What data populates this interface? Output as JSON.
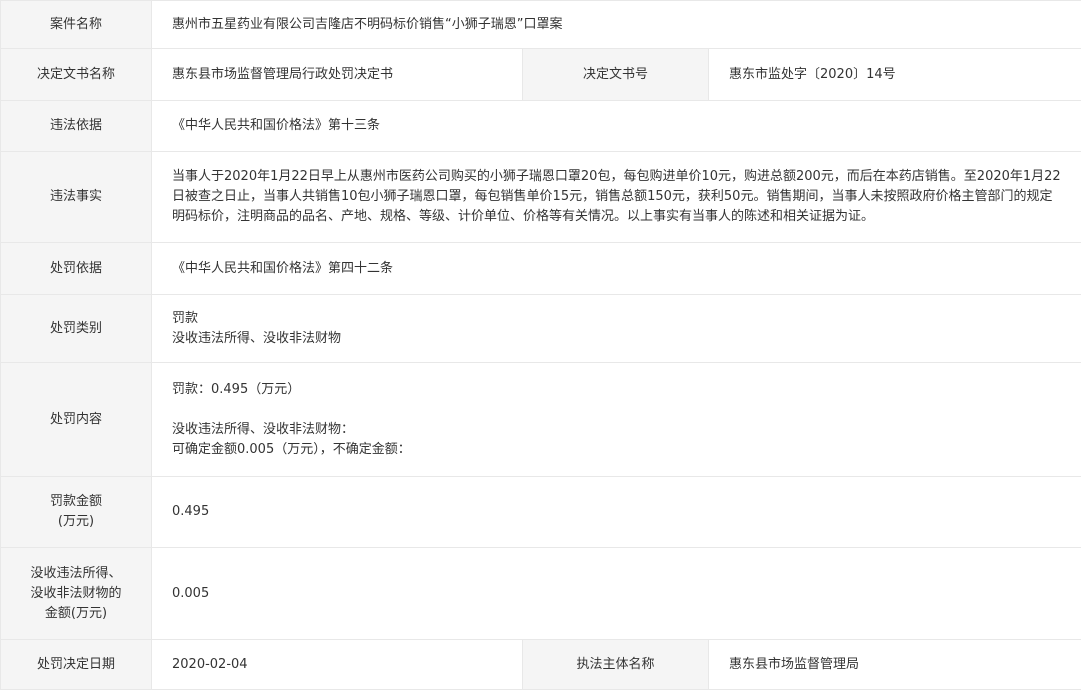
{
  "rows": {
    "case_name": {
      "label": "案件名称",
      "value": "惠州市五星药业有限公司吉隆店不明码标价销售“小狮子瑞恩”口罩案"
    },
    "decision_doc_name": {
      "label": "决定文书名称",
      "value": "惠东县市场监督管理局行政处罚决定书"
    },
    "decision_doc_no": {
      "label": "决定文书号",
      "value": "惠东市监处字〔2020〕14号"
    },
    "violation_basis": {
      "label": "违法依据",
      "value": "《中华人民共和国价格法》第十三条"
    },
    "violation_facts": {
      "label": "违法事实",
      "value": "当事人于2020年1月22日早上从惠州市医药公司购买的小狮子瑞恩口罩20包，每包购进单价10元，购进总额200元，而后在本药店销售。至2020年1月22日被查之日止，当事人共销售10包小狮子瑞恩口罩，每包销售单价15元，销售总额150元，获利50元。销售期间，当事人未按照政府价格主管部门的规定明码标价，注明商品的品名、产地、规格、等级、计价单位、价格等有关情况。以上事实有当事人的陈述和相关证据为证。"
    },
    "penalty_basis": {
      "label": "处罚依据",
      "value": "《中华人民共和国价格法》第四十二条"
    },
    "penalty_type": {
      "label": "处罚类别",
      "lines": [
        "罚款",
        "没收违法所得、没收非法财物"
      ]
    },
    "penalty_content": {
      "label": "处罚内容",
      "fine": "罚款：0.495（万元）",
      "confiscation_title": "没收违法所得、没收非法财物：",
      "confiscation_amount": "可确定金额0.005（万元），不确定金额："
    },
    "fine_amount": {
      "label_line1": "罚款金额",
      "label_line2": "(万元)",
      "value": "0.495"
    },
    "confiscation_amount": {
      "label_line1": "没收违法所得、",
      "label_line2": "没收非法财物的",
      "label_line3": "金额(万元)",
      "value": "0.005"
    },
    "decision_date": {
      "label": "处罚决定日期",
      "value": "2020-02-04"
    },
    "enforcement_agency": {
      "label": "执法主体名称",
      "value": "惠东县市场监督管理局"
    }
  }
}
